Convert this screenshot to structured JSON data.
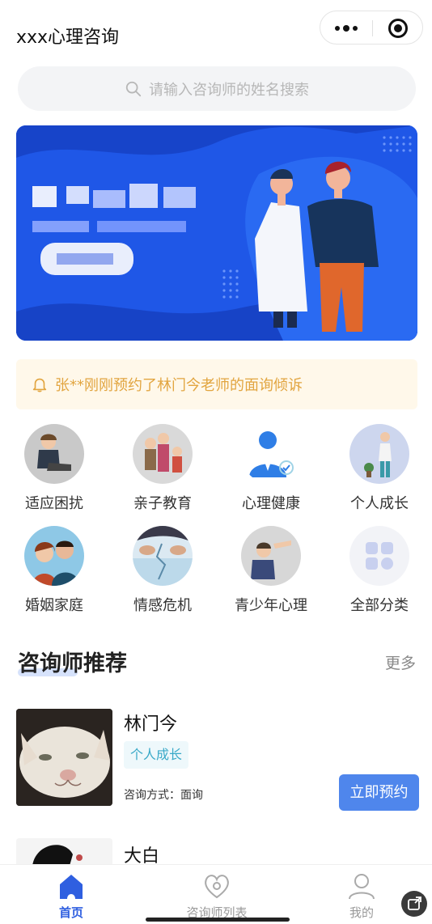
{
  "header": {
    "title": "xxx心理咨询"
  },
  "search": {
    "placeholder": "请输入咨询师的姓名搜索"
  },
  "notice": {
    "text": "张**刚刚预约了林门今老师的面询倾诉"
  },
  "categories": [
    {
      "label": "适应困扰",
      "icon": "sitting-person-icon"
    },
    {
      "label": "亲子教育",
      "icon": "family-icon"
    },
    {
      "label": "心理健康",
      "icon": "doctor-icon"
    },
    {
      "label": "个人成长",
      "icon": "standing-person-icon"
    },
    {
      "label": "婚姻家庭",
      "icon": "couple-icon"
    },
    {
      "label": "情感危机",
      "icon": "broken-ice-icon"
    },
    {
      "label": "青少年心理",
      "icon": "teen-icon"
    },
    {
      "label": "全部分类",
      "icon": "grid-icon"
    }
  ],
  "section": {
    "title": "咨询师推荐",
    "more": "更多"
  },
  "counselors": [
    {
      "name": "林门今",
      "tag": "个人成长",
      "method": "咨询方式：面询",
      "button": "立即预约"
    },
    {
      "name": "大白"
    }
  ],
  "tabbar": [
    {
      "label": "首页",
      "icon": "home-icon",
      "active": true
    },
    {
      "label": "咨询师列表",
      "icon": "stethoscope-heart-icon",
      "active": false
    },
    {
      "label": "我的",
      "icon": "user-icon",
      "active": false
    }
  ],
  "colors": {
    "primary": "#4f86ec",
    "banner": "#1f57e7",
    "notice_bg": "#fff8ea",
    "notice_text": "#e2a540",
    "tag_text": "#3aa9c8"
  }
}
